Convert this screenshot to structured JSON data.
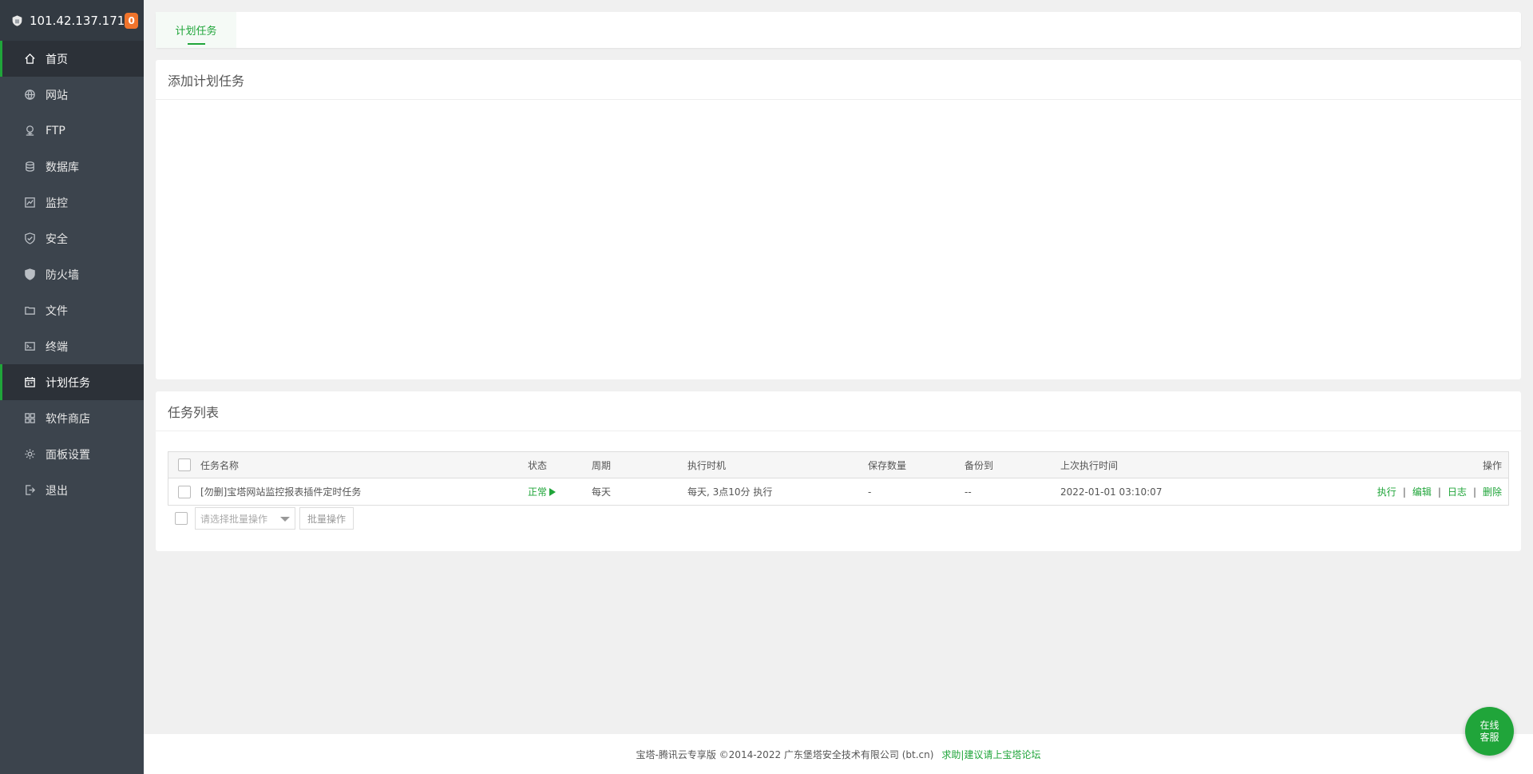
{
  "sidebar": {
    "ip": "101.42.137.171",
    "badge": "0",
    "items": [
      {
        "label": "首页",
        "icon": "home-icon"
      },
      {
        "label": "网站",
        "icon": "globe-icon"
      },
      {
        "label": "FTP",
        "icon": "ftp-icon"
      },
      {
        "label": "数据库",
        "icon": "database-icon"
      },
      {
        "label": "监控",
        "icon": "monitor-icon"
      },
      {
        "label": "安全",
        "icon": "shield-icon"
      },
      {
        "label": "防火墙",
        "icon": "firewall-icon"
      },
      {
        "label": "文件",
        "icon": "folder-icon"
      },
      {
        "label": "终端",
        "icon": "terminal-icon"
      },
      {
        "label": "计划任务",
        "icon": "calendar-icon",
        "active": true
      },
      {
        "label": "软件商店",
        "icon": "apps-icon"
      },
      {
        "label": "面板设置",
        "icon": "gear-icon"
      },
      {
        "label": "退出",
        "icon": "logout-icon"
      }
    ]
  },
  "tabs": [
    {
      "label": "计划任务"
    }
  ],
  "add_panel": {
    "title": "添加计划任务"
  },
  "list_panel": {
    "title": "任务列表",
    "columns": [
      "任务名称",
      "状态",
      "周期",
      "执行时机",
      "保存数量",
      "备份到",
      "上次执行时间",
      "操作"
    ],
    "rows": [
      {
        "name": "[勿删]宝塔网站监控报表插件定时任务",
        "status": "正常",
        "cycle": "每天",
        "timing": "每天, 3点10分 执行",
        "save_count": "-",
        "backup_to": "--",
        "last_run": "2022-01-01 03:10:07",
        "ops": [
          "执行",
          "编辑",
          "日志",
          "删除"
        ]
      }
    ],
    "batch_placeholder": "请选择批量操作",
    "batch_button": "批量操作"
  },
  "footer": {
    "copyright": "宝塔-腾讯云专享版 ©2014-2022 广东堡塔安全技术有限公司 (bt.cn)",
    "link": "求助|建议请上宝塔论坛"
  },
  "chat": {
    "line1": "在线",
    "line2": "客服"
  },
  "colors": {
    "accent": "#20a53a",
    "sidebar": "#3c444d",
    "badge": "#f0742c"
  }
}
